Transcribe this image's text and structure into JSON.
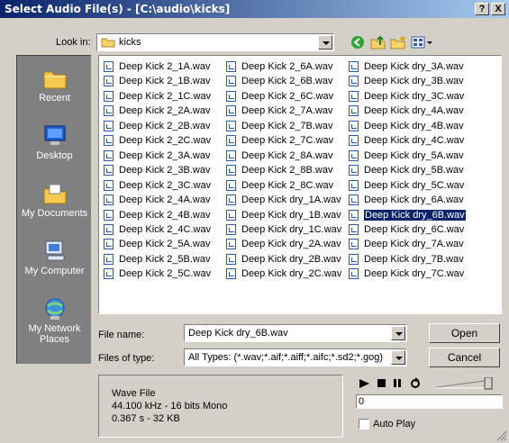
{
  "window": {
    "title": "Select Audio File(s) - [C:\\audio\\kicks]",
    "help_btn": "?",
    "close_btn": "X"
  },
  "lookin": {
    "label": "Look in:",
    "value": "kicks"
  },
  "places": [
    {
      "name": "Recent",
      "icon": "recent-folder-icon"
    },
    {
      "name": "Desktop",
      "icon": "desktop-icon"
    },
    {
      "name": "My Documents",
      "icon": "my-documents-icon"
    },
    {
      "name": "My Computer",
      "icon": "my-computer-icon"
    },
    {
      "name": "My Network Places",
      "icon": "network-icon"
    }
  ],
  "files": {
    "col1": [
      "Deep Kick 2_1A.wav",
      "Deep Kick 2_1B.wav",
      "Deep Kick 2_1C.wav",
      "Deep Kick 2_2A.wav",
      "Deep Kick 2_2B.wav",
      "Deep Kick 2_2C.wav",
      "Deep Kick 2_3A.wav",
      "Deep Kick 2_3B.wav",
      "Deep Kick 2_3C.wav",
      "Deep Kick 2_4A.wav",
      "Deep Kick 2_4B.wav",
      "Deep Kick 2_4C.wav",
      "Deep Kick 2_5A.wav",
      "Deep Kick 2_5B.wav",
      "Deep Kick 2_5C.wav"
    ],
    "col2": [
      "Deep Kick 2_6A.wav",
      "Deep Kick 2_6B.wav",
      "Deep Kick 2_6C.wav",
      "Deep Kick 2_7A.wav",
      "Deep Kick 2_7B.wav",
      "Deep Kick 2_7C.wav",
      "Deep Kick 2_8A.wav",
      "Deep Kick 2_8B.wav",
      "Deep Kick 2_8C.wav",
      "Deep Kick dry_1A.wav",
      "Deep Kick dry_1B.wav",
      "Deep Kick dry_1C.wav",
      "Deep Kick dry_2A.wav",
      "Deep Kick dry_2B.wav",
      "Deep Kick dry_2C.wav"
    ],
    "col3": [
      "Deep Kick dry_3A.wav",
      "Deep Kick dry_3B.wav",
      "Deep Kick dry_3C.wav",
      "Deep Kick dry_4A.wav",
      "Deep Kick dry_4B.wav",
      "Deep Kick dry_4C.wav",
      "Deep Kick dry_5A.wav",
      "Deep Kick dry_5B.wav",
      "Deep Kick dry_5C.wav",
      "Deep Kick dry_6A.wav",
      "Deep Kick dry_6B.wav",
      "Deep Kick dry_6C.wav",
      "Deep Kick dry_7A.wav",
      "Deep Kick dry_7B.wav",
      "Deep Kick dry_7C.wav"
    ],
    "selected": "Deep Kick dry_6B.wav"
  },
  "filename": {
    "label": "File name:",
    "value": "Deep Kick dry_6B.wav"
  },
  "filetype": {
    "label": "Files of type:",
    "value": "All Types: (*.wav;*.aif;*.aiff;*.aifc;*.sd2;*.gog)"
  },
  "buttons": {
    "open": "Open",
    "cancel": "Cancel"
  },
  "info": {
    "line1": "Wave File",
    "line2": "44.100 kHz - 16 bits Mono",
    "line3": "0.367 s - 32 KB"
  },
  "player": {
    "position": "0",
    "autoplay_label": "Auto Play",
    "autoplay_checked": false
  }
}
